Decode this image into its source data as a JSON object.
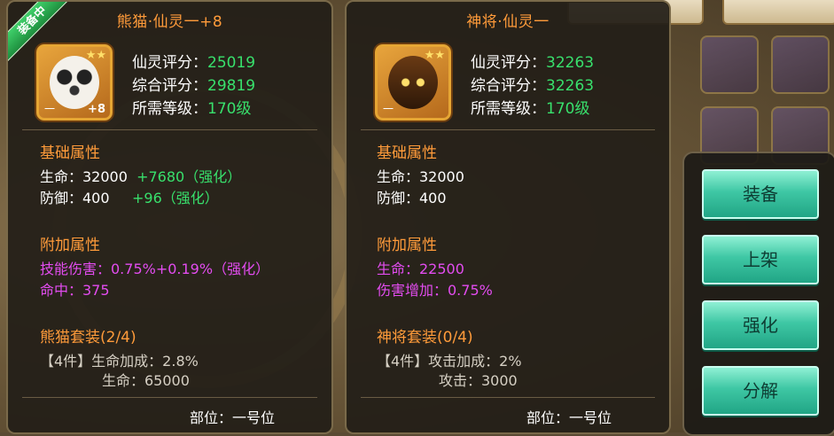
{
  "left": {
    "badge": "装备中",
    "title": "熊猫·仙灵一+8",
    "avatar": {
      "rank": "一",
      "plus": "+8",
      "stars": "★★"
    },
    "stats": [
      {
        "label": "仙灵评分：",
        "value": "25019"
      },
      {
        "label": "综合评分：",
        "value": "29819"
      },
      {
        "label": "所需等级：",
        "value": "170级"
      }
    ],
    "base_title": "基础属性",
    "base": [
      {
        "text": "生命：32000",
        "bonus": "+7680（强化）"
      },
      {
        "text": "防御：400",
        "bonus": "+96（强化）"
      }
    ],
    "extra_title": "附加属性",
    "extra": [
      {
        "text": "技能伤害：0.75%+0.19%（强化）"
      },
      {
        "text": "命中：375"
      }
    ],
    "set_title": "熊猫套装(2/4)",
    "set_lines": [
      "【4件】生命加成：2.8%",
      "生命：65000"
    ],
    "footer": "部位：一号位"
  },
  "right": {
    "title": "神将·仙灵一",
    "avatar": {
      "rank": "一",
      "stars": "★★"
    },
    "stats": [
      {
        "label": "仙灵评分：",
        "value": "32263"
      },
      {
        "label": "综合评分：",
        "value": "32263"
      },
      {
        "label": "所需等级：",
        "value": "170级"
      }
    ],
    "base_title": "基础属性",
    "base": [
      {
        "text": "生命：32000"
      },
      {
        "text": "防御：400"
      }
    ],
    "extra_title": "附加属性",
    "extra": [
      {
        "text": "生命：22500"
      },
      {
        "text": "伤害增加：0.75%"
      }
    ],
    "set_title": "神将套装(0/4)",
    "set_lines": [
      "【4件】攻击加成：2%",
      "攻击：3000"
    ],
    "footer": "部位：一号位"
  },
  "menu": {
    "equip": "装备",
    "list": "上架",
    "enhance": "强化",
    "decompose": "分解"
  },
  "colors": {
    "title": "#ff9b3a",
    "value_green": "#38e06c",
    "extra_magenta": "#e34cf0",
    "button": "#3ec7a4"
  }
}
